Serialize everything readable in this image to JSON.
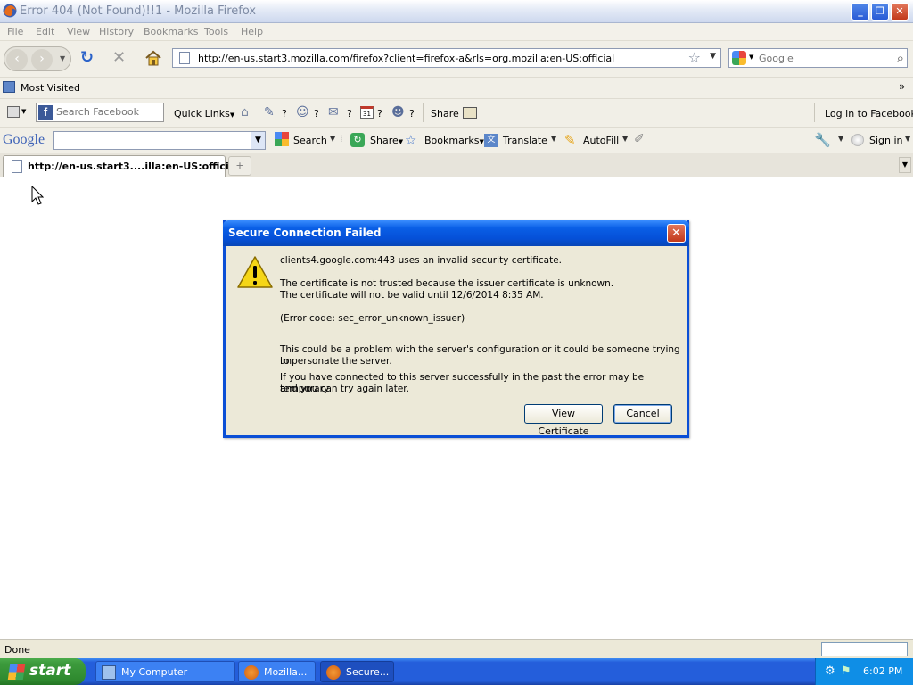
{
  "window": {
    "title": "Error 404 (Not Found)!!1 - Mozilla Firefox"
  },
  "menu": [
    "File",
    "Edit",
    "View",
    "History",
    "Bookmarks",
    "Tools",
    "Help"
  ],
  "nav": {
    "url": "http://en-us.start3.mozilla.com/firefox?client=firefox-a&rls=org.mozilla:en-US:official",
    "search_placeholder": "Google"
  },
  "bookmarks": {
    "most_visited": "Most Visited",
    "overflow": "»"
  },
  "facebook": {
    "search_placeholder": "Search Facebook",
    "quick_links": "Quick Links",
    "q1": "?",
    "q2": "?",
    "q3": "?",
    "q4": "?",
    "q5": "?",
    "calendar_day": "31",
    "share": "Share",
    "login": "Log in to Facebook"
  },
  "google_toolbar": {
    "logo": "Google",
    "search": "Search",
    "share": "Share",
    "bookmarks": "Bookmarks",
    "translate": "Translate",
    "autofill": "AutoFill",
    "sign_in": "Sign in"
  },
  "tab": {
    "title": "http://en-us.start3....illa:en-US:official"
  },
  "dialog": {
    "title": "Secure Connection Failed",
    "line1": "clients4.google.com:443 uses an invalid security certificate.",
    "line2": "The certificate is not trusted because the issuer certificate is unknown.",
    "line3": "The certificate will not be valid until 12/6/2014 8:35 AM.",
    "line4": "(Error code: sec_error_unknown_issuer)",
    "line5": "This could be a problem with the server's configuration or it could be someone trying to",
    "line6": "impersonate the server.",
    "line7": "If you have connected to this server successfully in the past the error may be temporary",
    "line8": "and you can try again later.",
    "view_certificate": "View Certificate",
    "cancel": "Cancel"
  },
  "status": {
    "text": "Done"
  },
  "taskbar": {
    "start": "start",
    "items": [
      "My Computer",
      "Mozilla...",
      "Secure..."
    ],
    "clock": "6:02 PM"
  }
}
